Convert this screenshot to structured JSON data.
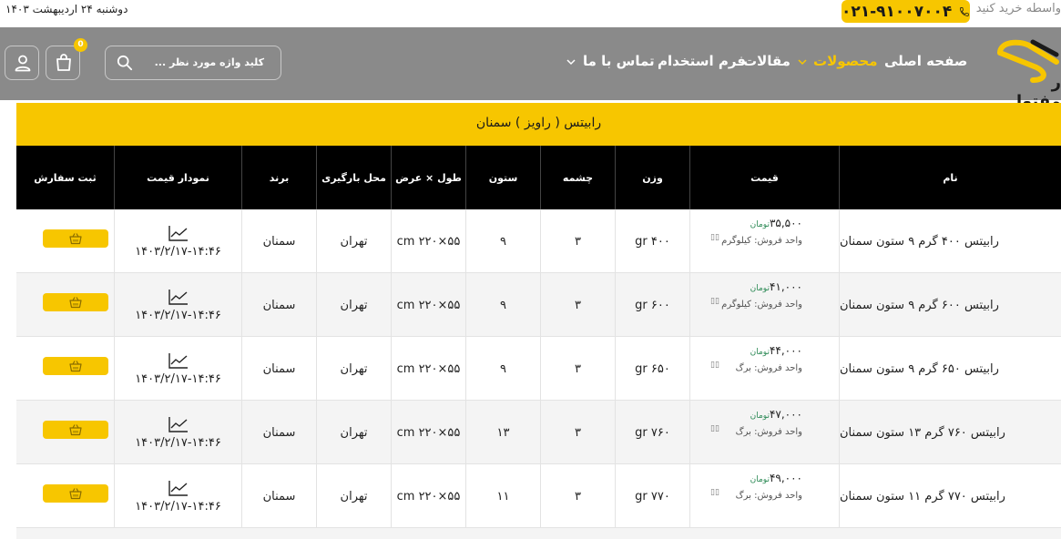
{
  "topbar": {
    "date": "دوشنبه ۲۴ اردیبهشت ۱۴۰۳",
    "buy_text": "واسطه خرید کنید",
    "phone": "۰۲۱-۹۱۰۰۷۰۰۴"
  },
  "header": {
    "logo_text": "ر مفتول",
    "nav": [
      {
        "label": "صفحه اصلی"
      },
      {
        "label": "محصولات"
      },
      {
        "label": "مقالات"
      },
      {
        "label": "فرم استخدام"
      },
      {
        "label": "تماس با ما"
      }
    ],
    "search_placeholder": "کلید واژه مورد نظر ...",
    "cart_count": "0"
  },
  "category": {
    "title": "رابیتس ( راویز )  سمنان"
  },
  "table": {
    "headers": [
      "نام",
      "قیمت",
      "وزن",
      "چشمه",
      "ستون",
      "طول × عرض",
      "محل بارگیری",
      "برند",
      "نمودار قیمت",
      "ثبت سفارش"
    ],
    "rows": [
      {
        "name": "رابیتس ۴۰۰ گرم ۹ ستون سمنان",
        "price": "۳۵,۵۰۰",
        "currency": "تومان",
        "unit": "واحد فروش: کیلوگرم",
        "weight": "۴۰۰ gr",
        "mesh": "۳",
        "column": "۹",
        "size": "۵۵×۲۲۰ cm",
        "location": "تهران",
        "brand": "سمنان",
        "date": "۱۴۰۳/۲/۱۷-۱۴:۴۶"
      },
      {
        "name": "رابیتس ۶۰۰ گرم ۹ ستون سمنان",
        "price": "۴۱,۰۰۰",
        "currency": "تومان",
        "unit": "واحد فروش: کیلوگرم",
        "weight": "۶۰۰ gr",
        "mesh": "۳",
        "column": "۹",
        "size": "۵۵×۲۲۰ cm",
        "location": "تهران",
        "brand": "سمنان",
        "date": "۱۴۰۳/۲/۱۷-۱۴:۴۶"
      },
      {
        "name": "رابیتس ۶۵۰ گرم ۹ ستون سمنان",
        "price": "۴۴,۰۰۰",
        "currency": "تومان",
        "unit": "واحد فروش: برگ",
        "weight": "۶۵۰ gr",
        "mesh": "۳",
        "column": "۹",
        "size": "۵۵×۲۲۰ cm",
        "location": "تهران",
        "brand": "سمنان",
        "date": "۱۴۰۳/۲/۱۷-۱۴:۴۶"
      },
      {
        "name": "رابیتس ۷۶۰ گرم ۱۳ ستون سمنان",
        "price": "۴۷,۰۰۰",
        "currency": "تومان",
        "unit": "واحد فروش: برگ",
        "weight": "۷۶۰ gr",
        "mesh": "۳",
        "column": "۱۳",
        "size": "۵۵×۲۲۰ cm",
        "location": "تهران",
        "brand": "سمنان",
        "date": "۱۴۰۳/۲/۱۷-۱۴:۴۶"
      },
      {
        "name": "رابیتس ۷۷۰ گرم ۱۱ ستون سمنان",
        "price": "۴۹,۰۰۰",
        "currency": "تومان",
        "unit": "واحد فروش: برگ",
        "weight": "۷۷۰ gr",
        "mesh": "۳",
        "column": "۱۱",
        "size": "۵۵×۲۲۰ cm",
        "location": "تهران",
        "brand": "سمنان",
        "date": "۱۴۰۳/۲/۱۷-۱۴:۴۶"
      }
    ]
  },
  "colors": {
    "accent": "#f7c600",
    "header_bg": "#8a8a8a",
    "table_head_bg": "#000000",
    "currency": "#2e8b57"
  }
}
